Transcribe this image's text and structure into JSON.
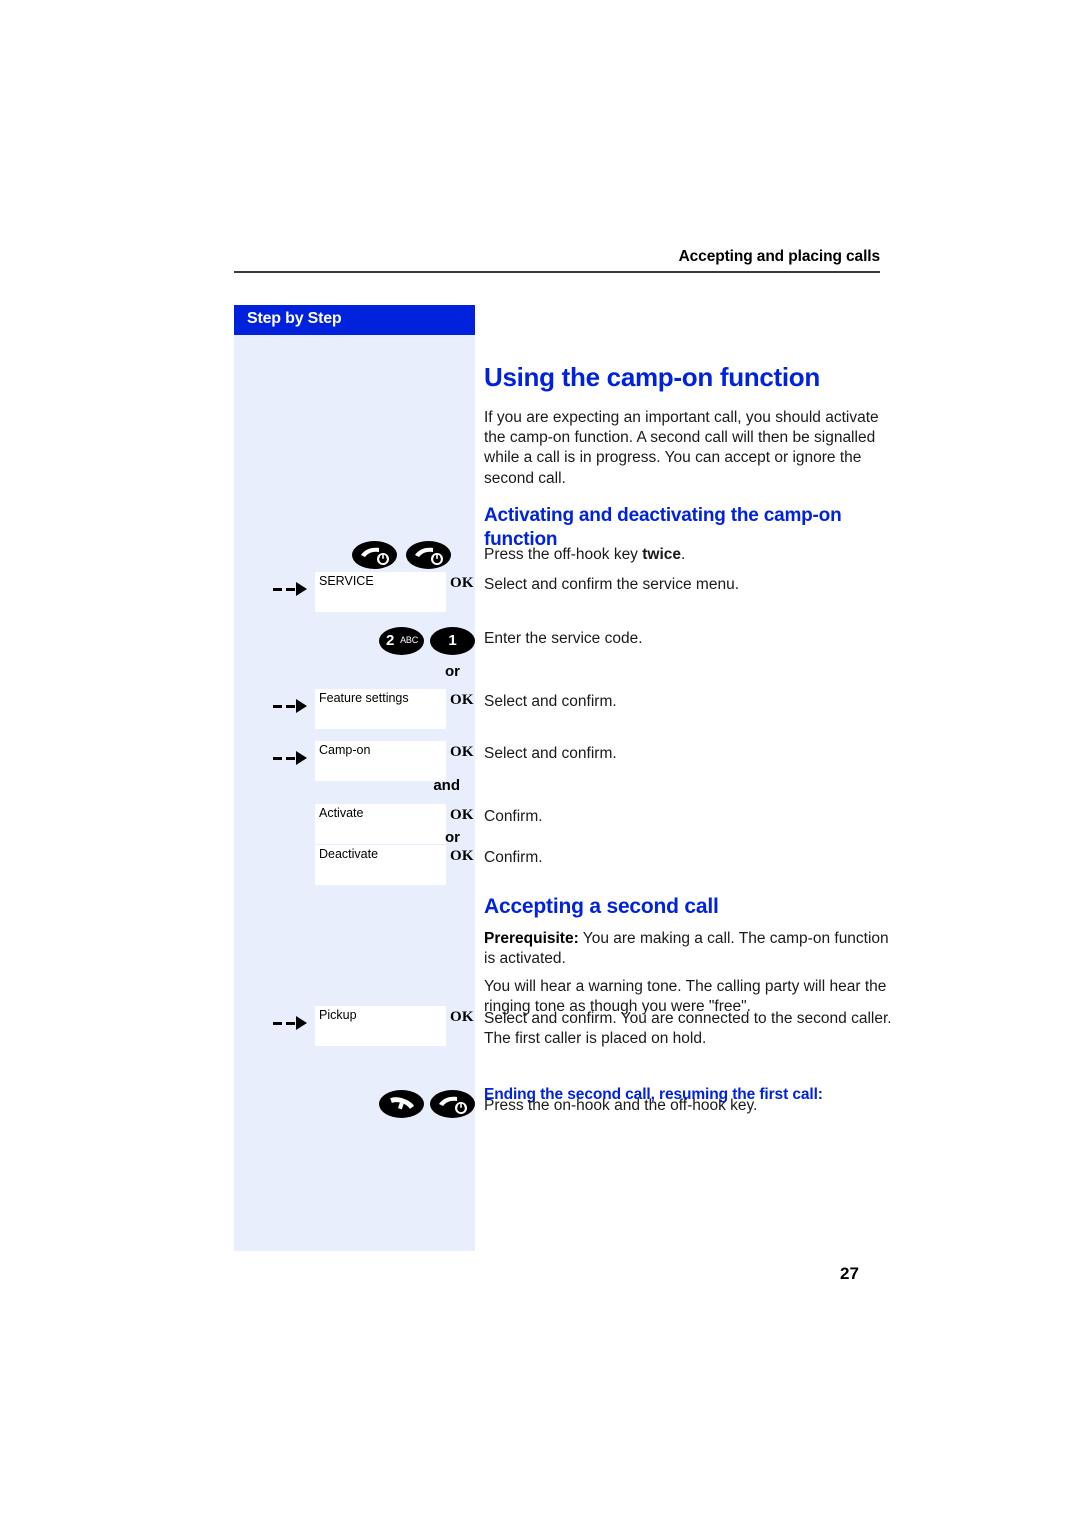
{
  "header": {
    "running_head": "Accepting and placing calls"
  },
  "sidebar": {
    "title": "Step by Step"
  },
  "page": {
    "number": "27"
  },
  "content": {
    "title": "Using the camp-on function",
    "intro": "If you are expecting an important call, you should activate the camp-on function. A second call will then be signalled while a call is in progress. You can accept or ignore the second call.",
    "section1_heading": "Activating and deactivating the camp-on function",
    "section2_heading": "Accepting a second call",
    "prereq_label": "Prerequisite:",
    "prereq_text": "You are making a call. The camp-on function is activated.",
    "warning_tone_text": "You will hear a warning tone. The calling party will hear the ringing tone as though you were \"free\".",
    "ending_heading": "Ending the second call, resuming the first call:"
  },
  "steps": [
    {
      "id": "offhook-twice",
      "icons": [
        "off-hook-key",
        "off-hook-key"
      ],
      "instruction_plain": "Press the off-hook key ",
      "instruction_bold": "twice",
      "instruction_tail": "."
    },
    {
      "id": "service",
      "arrow": true,
      "display": "SERVICE",
      "softkey": "OK",
      "instruction": "Select and confirm the service menu."
    },
    {
      "id": "service-code",
      "keys": [
        {
          "digit": "2",
          "letters": "ABC"
        },
        {
          "digit": "1",
          "letters": ""
        }
      ],
      "instruction": "Enter the service code."
    },
    {
      "id": "connector-or-1",
      "connector": "or"
    },
    {
      "id": "feature-settings",
      "arrow": true,
      "display": "Feature settings",
      "softkey": "OK",
      "instruction": "Select and confirm."
    },
    {
      "id": "camp-on",
      "arrow": true,
      "display": "Camp-on",
      "softkey": "OK",
      "instruction": "Select and confirm."
    },
    {
      "id": "connector-and",
      "connector": "and"
    },
    {
      "id": "activate",
      "arrow": false,
      "display": "Activate",
      "softkey": "OK",
      "instruction": "Confirm."
    },
    {
      "id": "connector-or-2",
      "connector": "or"
    },
    {
      "id": "deactivate",
      "arrow": false,
      "display": "Deactivate",
      "softkey": "OK",
      "instruction": "Confirm."
    },
    {
      "id": "pickup",
      "arrow": true,
      "display": "Pickup",
      "softkey": "OK",
      "instruction": "Select and confirm. You are connected to the second caller. The first caller is placed on hold."
    },
    {
      "id": "onhook-offhook",
      "icons": [
        "on-hook-key",
        "off-hook-key"
      ],
      "instruction": "Press the on-hook and the off-hook key."
    }
  ],
  "colors": {
    "brand_blue": "#0022dd",
    "panel_blue": "#e8eefb",
    "text": "#1a1a1a"
  }
}
